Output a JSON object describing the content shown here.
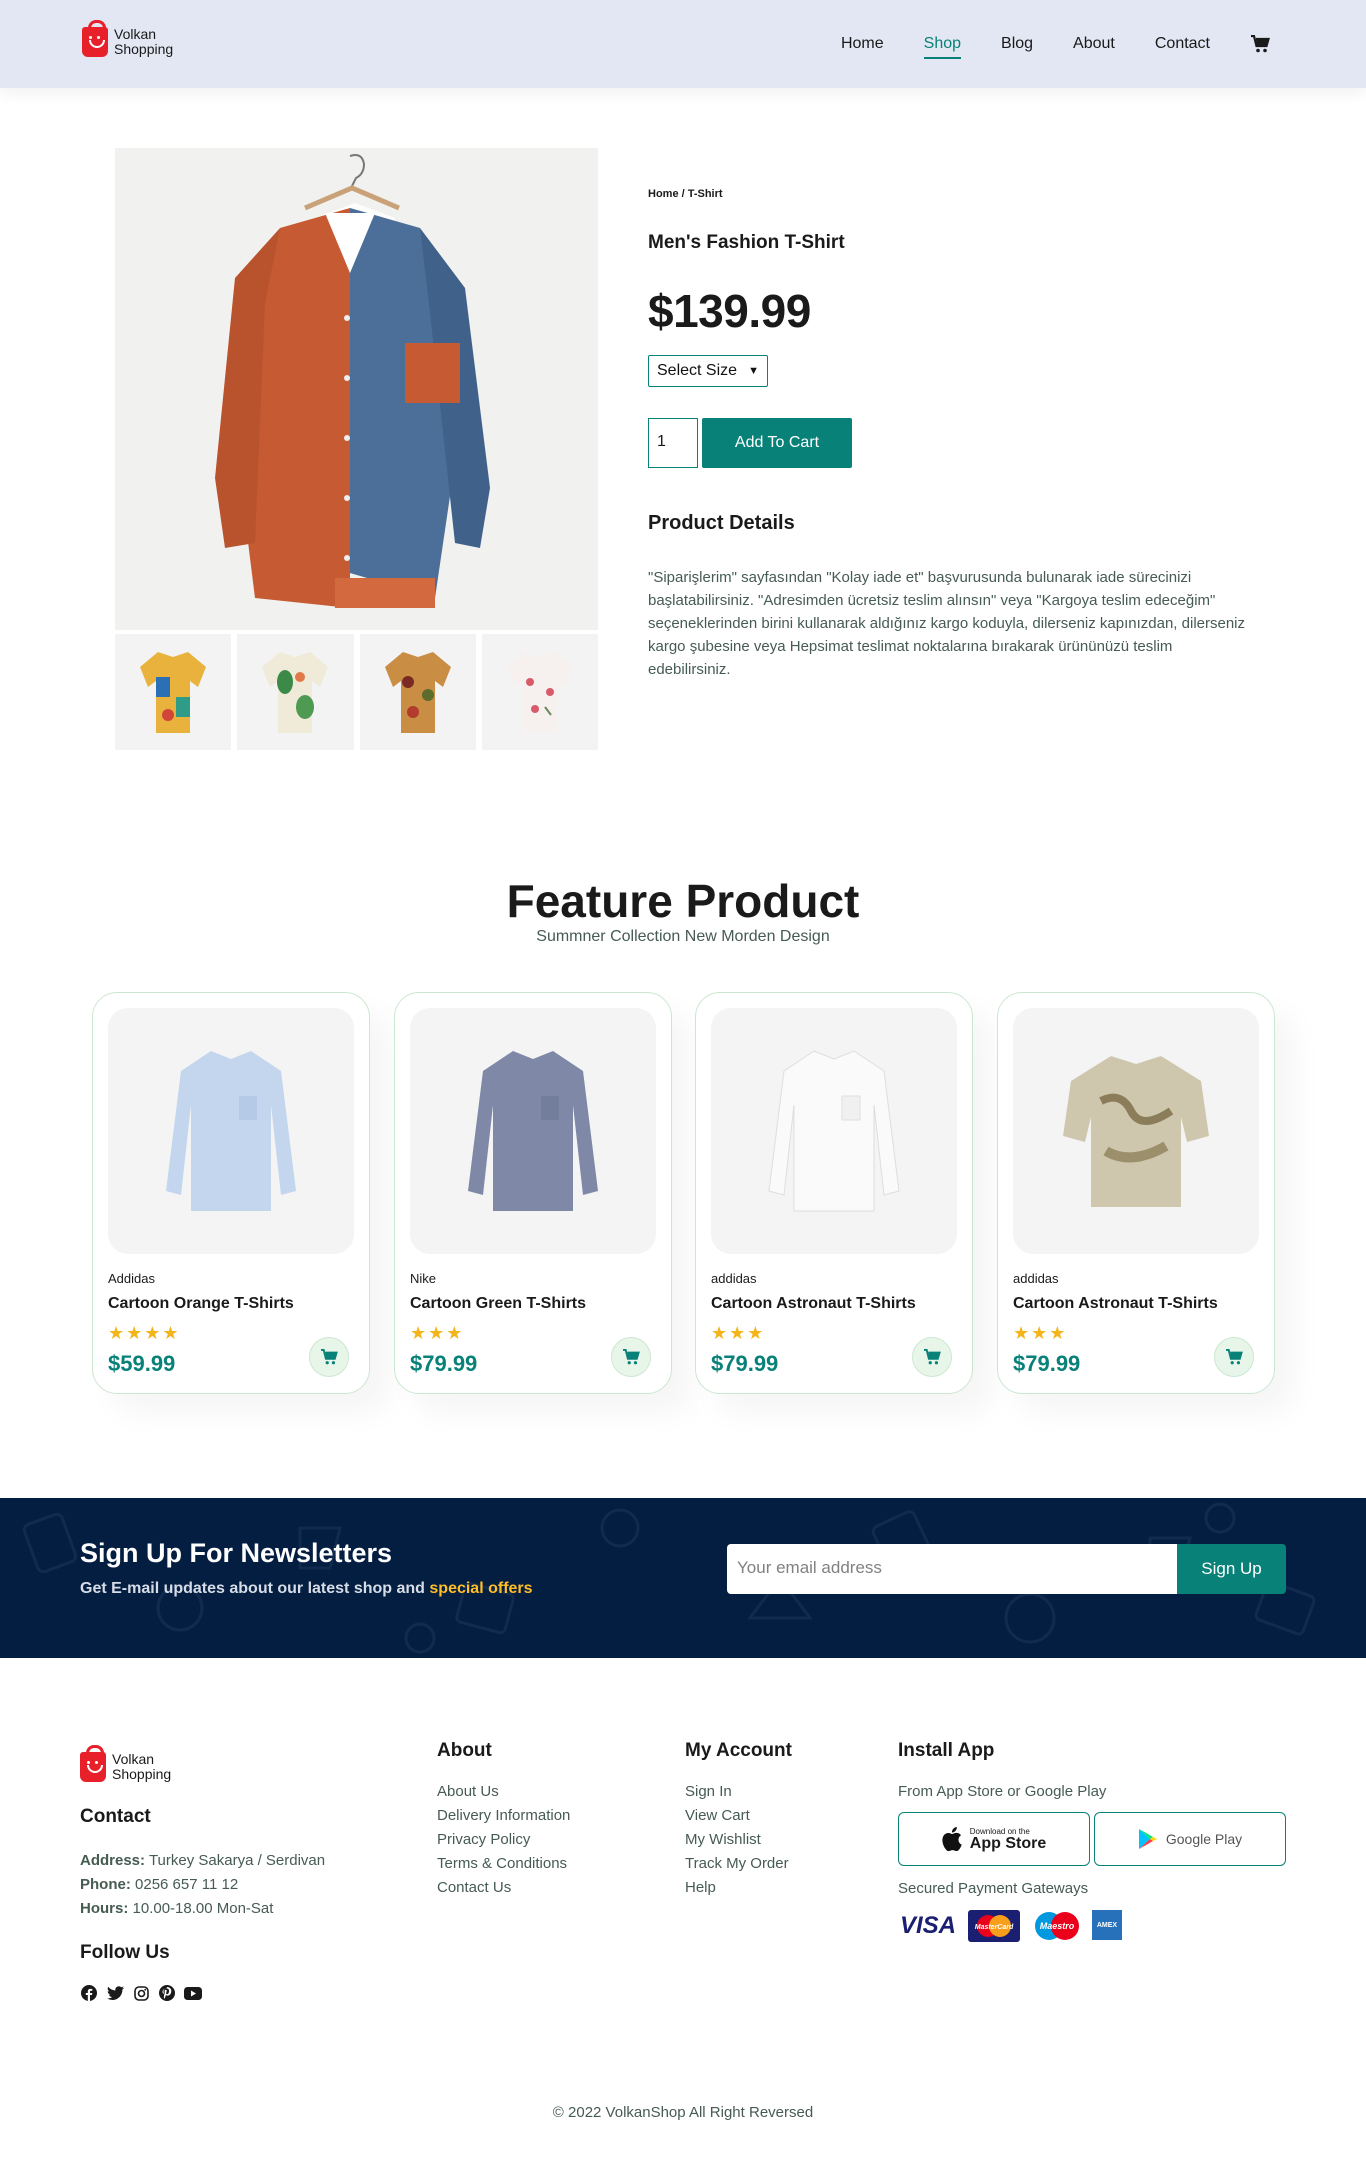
{
  "header": {
    "logo_line1": "Volkan",
    "logo_line2": "Shopping",
    "nav": [
      "Home",
      "Shop",
      "Blog",
      "About",
      "Contact"
    ],
    "active_nav": "Shop",
    "cart_icon": "cart-icon"
  },
  "product": {
    "breadcrumb": "Home / T-Shirt",
    "title": "Men's Fashion T-Shirt",
    "price": "$139.99",
    "size_select": "Select Size",
    "quantity": "1",
    "add_to_cart": "Add To Cart",
    "details_heading": "Product Details",
    "details_text": "\"Siparişlerim\" sayfasından \"Kolay iade et\" başvurusunda bulunarak iade sürecinizi başlatabilirsiniz. \"Adresimden ücretsiz teslim alınsın\" veya \"Kargoya teslim edeceğim\" seçeneklerinden birini kullanarak aldığınız kargo koduyla, dilerseniz kapınızdan, dilerseniz kargo şubesine veya Hepsimat teslimat noktalarına bırakarak ürününüzü teslim edebilirsiniz."
  },
  "featured": {
    "title": "Feature Product",
    "subtitle": "Summner Collection New Morden Design",
    "cards": [
      {
        "brand": "Addidas",
        "name": "Cartoon Orange T-Shirts",
        "stars": "★★★★",
        "price": "$59.99",
        "rating": 4
      },
      {
        "brand": "Nike",
        "name": "Cartoon Green T-Shirts",
        "stars": "★★★",
        "price": "$79.99",
        "rating": 3
      },
      {
        "brand": "addidas",
        "name": "Cartoon Astronaut T-Shirts",
        "stars": "★★★",
        "price": "$79.99",
        "rating": 3
      },
      {
        "brand": "addidas",
        "name": "Cartoon Astronaut T-Shirts",
        "stars": "★★★",
        "price": "$79.99",
        "rating": 3
      }
    ]
  },
  "newsletter": {
    "heading": "Sign Up For Newsletters",
    "text_before": "Get E-mail updates about our latest shop and",
    "text_highlight": "special offers",
    "email_placeholder": "Your email address",
    "button": "Sign Up"
  },
  "footer": {
    "logo_line1": "Volkan",
    "logo_line2": "Shopping",
    "contact_heading": "Contact",
    "address_label": "Address:",
    "address": "Turkey Sakarya / Serdivan",
    "phone_label": "Phone:",
    "phone": "0256 657 11 12",
    "hours_label": "Hours:",
    "hours": "10.00-18.00 Mon-Sat",
    "follow_heading": "Follow Us",
    "social_icons": [
      "facebook-icon",
      "twitter-icon",
      "instagram-icon",
      "pinterest-icon",
      "youtube-icon"
    ],
    "about_heading": "About",
    "about_links": [
      "About Us",
      "Delivery Information",
      "Privacy Policy",
      "Terms & Conditions",
      "Contact Us"
    ],
    "account_heading": "My Account",
    "account_links": [
      "Sign In",
      "View Cart",
      "My Wishlist",
      "Track My Order",
      "Help"
    ],
    "app_heading": "Install App",
    "app_text": "From App Store or Google Play",
    "app_store_small": "Download on the",
    "app_store": "App Store",
    "google_play": "Google Play",
    "payment_text": "Secured Payment Gateways",
    "payment_visa": "VISA",
    "payment_mastercard": "MasterCard",
    "payment_maestro": "Maestro",
    "payment_amex": "AMEX",
    "copyright": "© 2022 VolkanShop All Right Reversed"
  },
  "colors": {
    "accent": "#088178",
    "header_bg": "#e3e6f3",
    "newsletter_bg": "#041e42",
    "highlight": "#ffbd27",
    "star": "#f3b519"
  }
}
